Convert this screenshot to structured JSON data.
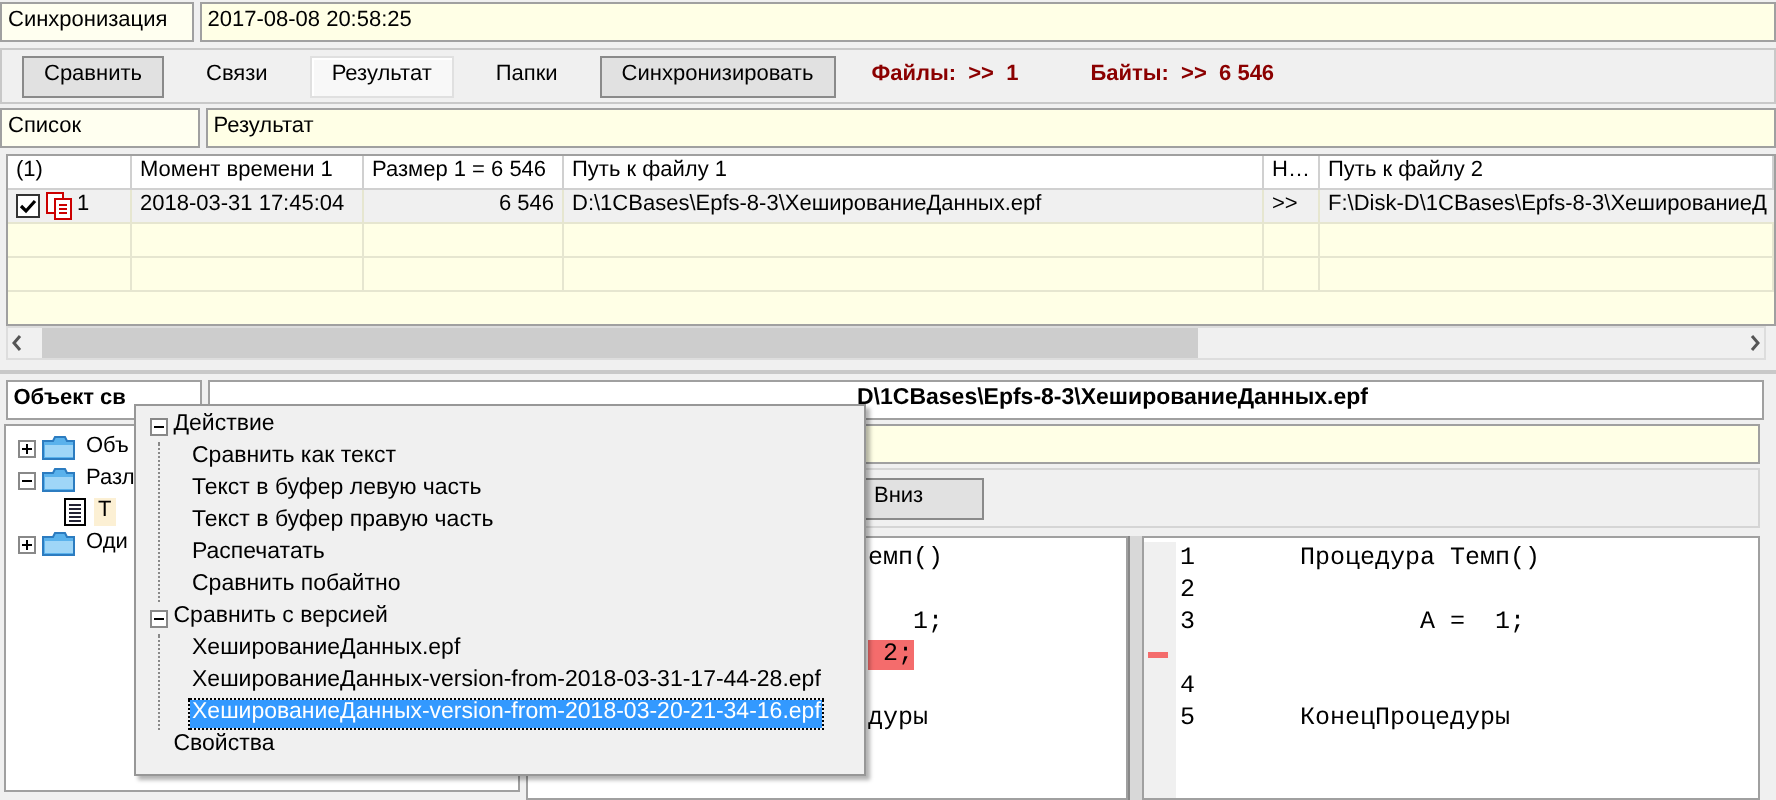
{
  "header": {
    "label": "Синхронизация",
    "value": "2017-08-08 20:58:25"
  },
  "toolbar": {
    "buttons": [
      {
        "label": "Сравнить",
        "kind": "button",
        "selected": false
      },
      {
        "label": "Связи",
        "kind": "tab",
        "selected": false
      },
      {
        "label": "Результат",
        "kind": "tab",
        "selected": true
      },
      {
        "label": "Папки",
        "kind": "tab",
        "selected": false
      },
      {
        "label": "Синхронизировать",
        "kind": "button",
        "selected": false
      }
    ],
    "stats": [
      {
        "label": "Файлы:",
        "value": ">>  1"
      },
      {
        "label": "Байты:",
        "value": ">>  6 546"
      }
    ]
  },
  "list_bar": {
    "label": "Список",
    "value": "Результат"
  },
  "table": {
    "columns": [
      "(1)",
      "Момент времени 1",
      "Размер 1 = 6 546",
      "Путь к файлу 1",
      "Н…",
      "Путь к файлу 2"
    ],
    "rows": [
      {
        "checked": true,
        "number": "1",
        "time": "2018-03-31 17:45:04",
        "size": "6 546",
        "path_1": "D:\\1CBases\\Epfs-8-3\\ХешированиеДанных.epf",
        "direction": ">>",
        "path_2": "F:\\Disk-D\\1CBases\\Epfs-8-3\\ХешированиеД"
      }
    ]
  },
  "object_field": {
    "label": "Объект св",
    "value": "D\\1CBases\\Epfs-8-3\\ХешированиеДанных.epf"
  },
  "tree": [
    {
      "label": "Объ",
      "expanded": false,
      "kind": "folder",
      "selected": false
    },
    {
      "label": "Разл",
      "expanded": true,
      "kind": "folder",
      "selected": false,
      "children": [
        {
          "label": "Т",
          "kind": "document",
          "selected": true
        }
      ]
    },
    {
      "label": "Оди",
      "expanded": false,
      "kind": "folder",
      "selected": false
    }
  ],
  "down_button": "Вниз",
  "left_code": [
    {
      "text": "емп()",
      "kind": "same"
    },
    {
      "kind": "same"
    },
    {
      "text": "   1;",
      "kind": "same"
    },
    {
      "text": " 2;",
      "kind": "removed"
    },
    {
      "kind": "same"
    },
    {
      "text": "дуры",
      "kind": "same"
    }
  ],
  "right_code": [
    {
      "number": "1",
      "text": "Процедура Темп()",
      "kind": "line"
    },
    {
      "number": "2",
      "kind": "line"
    },
    {
      "number": "3",
      "text": "        A =  1;",
      "kind": "line"
    },
    {
      "kind": "gap"
    },
    {
      "number": "4",
      "kind": "line"
    },
    {
      "number": "5",
      "text": "КонецПроцедуры",
      "kind": "line"
    }
  ],
  "context_menu": [
    {
      "label": "Действие",
      "expanded": true,
      "children": [
        {
          "label": "Сравнить как текст",
          "selected": false
        },
        {
          "label": "Текст в буфер левую часть",
          "selected": false
        },
        {
          "label": "Текст в буфер правую часть",
          "selected": false
        },
        {
          "label": "Распечатать",
          "selected": false
        },
        {
          "label": "Сравнить побайтно",
          "selected": false
        }
      ]
    },
    {
      "label": "Сравнить с версией",
      "expanded": true,
      "children": [
        {
          "label": "ХешированиеДанных.epf",
          "selected": false
        },
        {
          "label": "ХешированиеДанных-version-from-2018-03-31-17-44-28.epf",
          "selected": false
        },
        {
          "label": "ХешированиеДанных-version-from-2018-03-20-21-34-16.epf",
          "selected": true
        }
      ]
    },
    {
      "label": "Свойства"
    }
  ]
}
